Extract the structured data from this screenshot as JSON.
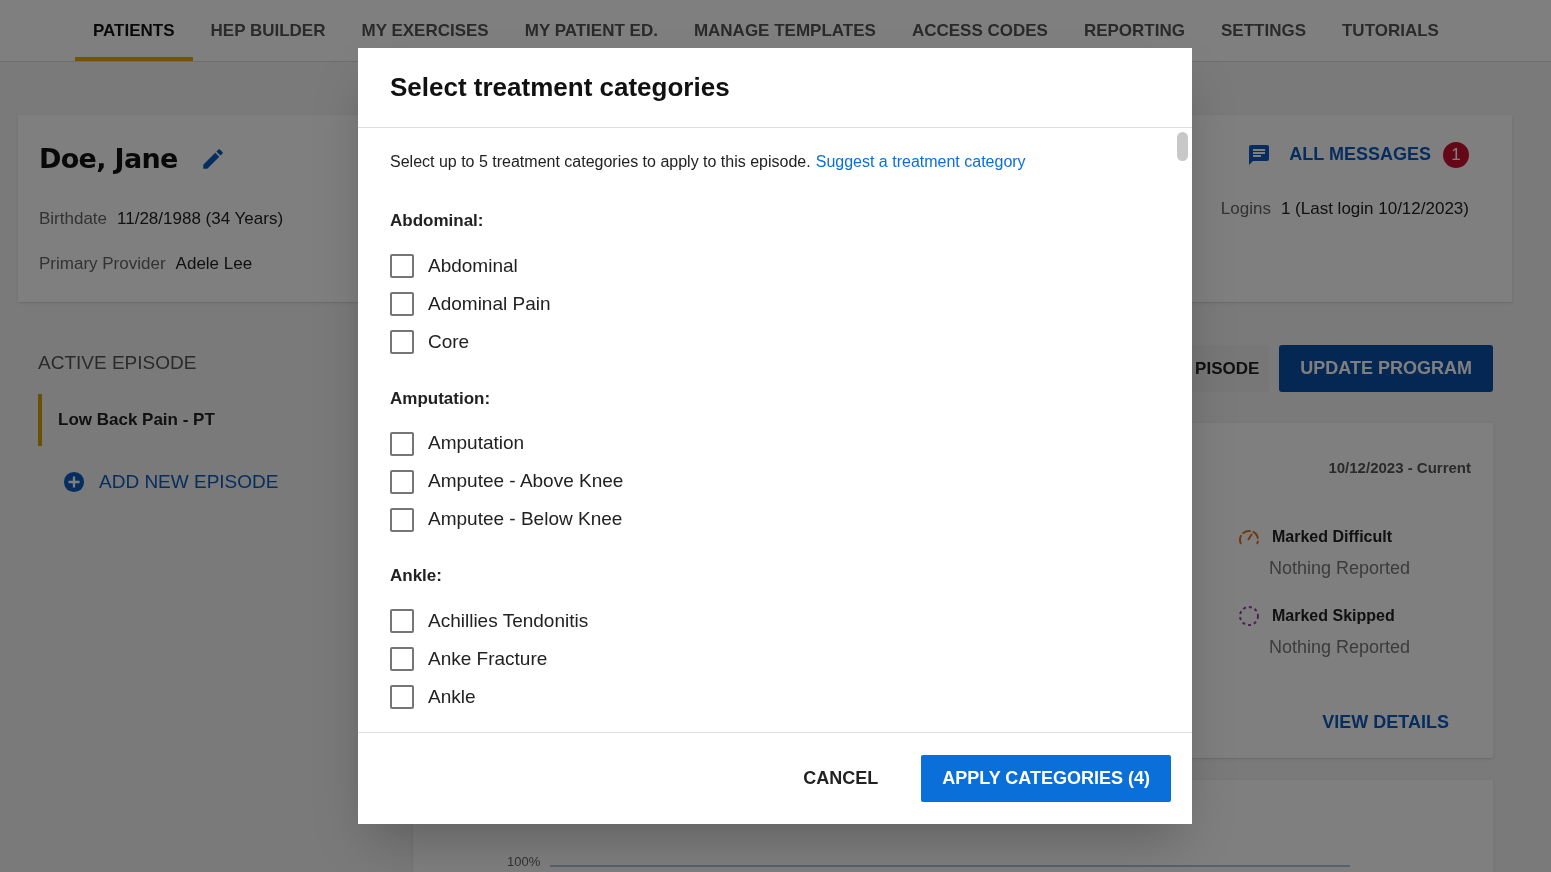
{
  "nav": {
    "tabs": [
      {
        "label": "PATIENTS",
        "selected": true
      },
      {
        "label": "HEP BUILDER",
        "selected": false
      },
      {
        "label": "MY EXERCISES",
        "selected": false
      },
      {
        "label": "MY PATIENT ED.",
        "selected": false
      },
      {
        "label": "MANAGE TEMPLATES",
        "selected": false
      },
      {
        "label": "ACCESS CODES",
        "selected": false
      },
      {
        "label": "REPORTING",
        "selected": false
      },
      {
        "label": "SETTINGS",
        "selected": false
      },
      {
        "label": "TUTORIALS",
        "selected": false
      }
    ]
  },
  "patient": {
    "name": "Doe, Jane",
    "fields": [
      {
        "label": "Birthdate",
        "value": "11/28/1988 (34 Years)"
      },
      {
        "label": "Primary Provider",
        "value": "Adele Lee"
      }
    ],
    "messages": {
      "label": "ALL MESSAGES",
      "count": "1"
    },
    "logins": {
      "label": "Logins",
      "value": "1 (Last login 10/12/2023)"
    }
  },
  "episodes": {
    "heading": "ACTIVE EPISODE",
    "items": [
      {
        "label": "Low Back Pain - PT",
        "selected": true
      }
    ],
    "add_label": "ADD NEW EPISODE"
  },
  "actions": [
    {
      "label": "PISODE",
      "kind": "secondary"
    },
    {
      "label": "UPDATE PROGRAM",
      "kind": "primary"
    }
  ],
  "summary_card": {
    "date_range": "10/12/2023 - Current",
    "stats": [
      {
        "kind": "difficult",
        "label": "Marked Difficult",
        "value": "Nothing Reported"
      },
      {
        "kind": "skipped",
        "label": "Marked Skipped",
        "value": "Nothing Reported"
      }
    ],
    "link": "VIEW DETAILS"
  },
  "adherence_chart": {
    "y_tick": "100%"
  },
  "dialog": {
    "title": "Select treatment categories",
    "intro": "Select up to 5 treatment categories to apply to this episode.",
    "suggest_link": "Suggest a treatment category",
    "groups": [
      {
        "heading": "Abdominal:",
        "options": [
          {
            "label": "Abdominal",
            "checked": false
          },
          {
            "label": "Adominal Pain",
            "checked": false
          },
          {
            "label": "Core",
            "checked": false
          }
        ]
      },
      {
        "heading": "Amputation:",
        "options": [
          {
            "label": "Amputation",
            "checked": false
          },
          {
            "label": "Amputee - Above Knee",
            "checked": false
          },
          {
            "label": "Amputee - Below Knee",
            "checked": false
          }
        ]
      },
      {
        "heading": "Ankle:",
        "options": [
          {
            "label": "Achillies Tendonitis",
            "checked": false
          },
          {
            "label": "Anke Fracture",
            "checked": false
          },
          {
            "label": "Ankle",
            "checked": false
          }
        ]
      }
    ],
    "buttons": [
      {
        "label": "CANCEL",
        "kind": "text"
      },
      {
        "label": "APPLY CATEGORIES (4)",
        "kind": "primary"
      }
    ]
  }
}
